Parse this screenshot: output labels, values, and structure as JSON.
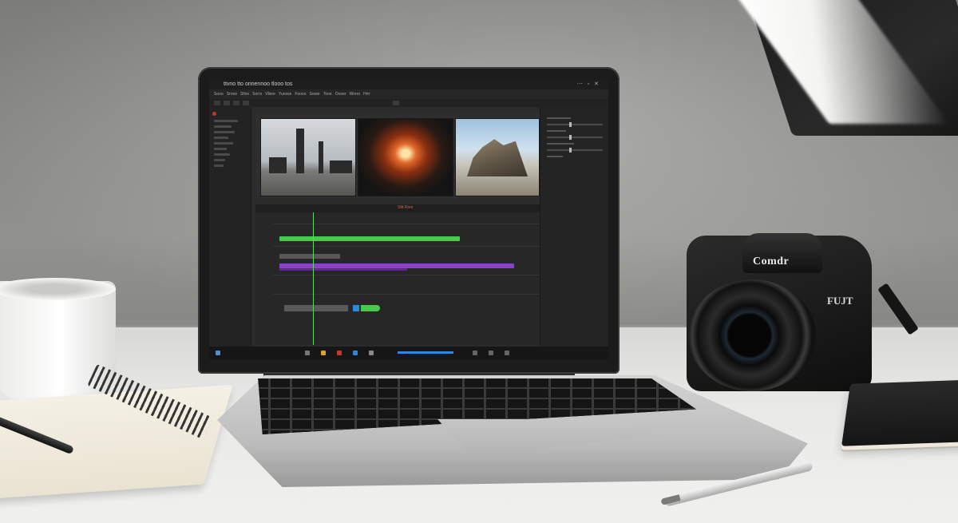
{
  "scene": {
    "camera": {
      "brand": "Comdr",
      "model": "FUJT"
    },
    "editor": {
      "window_title": "ttvno tto onnennoo tlooo tos",
      "menu": [
        "Sooo",
        "Srooe",
        "Slloo",
        "Sorrs",
        "Vllere",
        "Yunsse",
        "Foooo",
        "Sooer",
        "Tooe",
        "Oooer",
        "Wrero",
        "Hrrr"
      ],
      "timeline_label": "Sttt Ronr"
    }
  },
  "colors": {
    "accent_green": "#4cc84c",
    "accent_purple": "#8a3fd1",
    "accent_orange": "#d9663a",
    "accent_blue": "#2e86de",
    "record_red": "#c0392b"
  },
  "icons": [
    "menu-icon",
    "search-icon",
    "windows-icon",
    "playhead-marker-icon"
  ]
}
